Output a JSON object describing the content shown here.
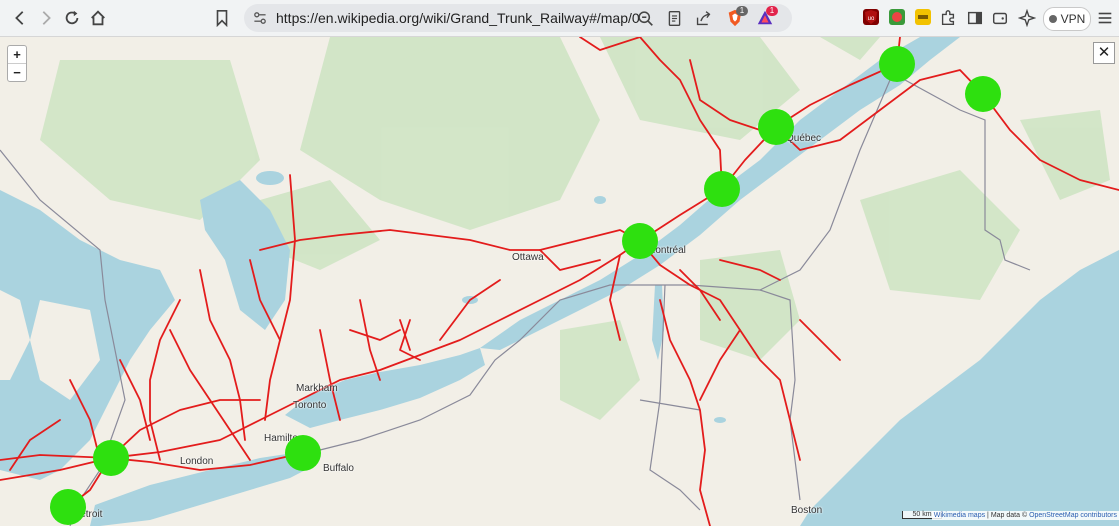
{
  "browser": {
    "url": "https://en.wikipedia.org/wiki/Grand_Trunk_Railway#/map/0",
    "shield_badge": "1",
    "alert_badge": "1",
    "vpn_label": "VPN"
  },
  "map": {
    "zoom_in_label": "+",
    "zoom_out_label": "−",
    "close_label": "✕",
    "cities": {
      "quebec": "Québec",
      "ottawa": "Ottawa",
      "montreal": "Montréal",
      "markham": "Markham",
      "toronto": "Toronto",
      "hamilton": "Hamilton",
      "london": "London",
      "buffalo": "Buffalo",
      "detroit": "Detroit",
      "boston": "Boston"
    },
    "scale_label": "50 km",
    "attribution": {
      "wikimedia": "Wikimedia maps",
      "separator": " | Map data © ",
      "osm": "OpenStreetMap contributors"
    },
    "colors": {
      "rail": "#e31c1c",
      "marker": "#2ee00f",
      "water": "#aad3df",
      "forest": "#cfe4c4",
      "land": "#f2efe7"
    }
  }
}
